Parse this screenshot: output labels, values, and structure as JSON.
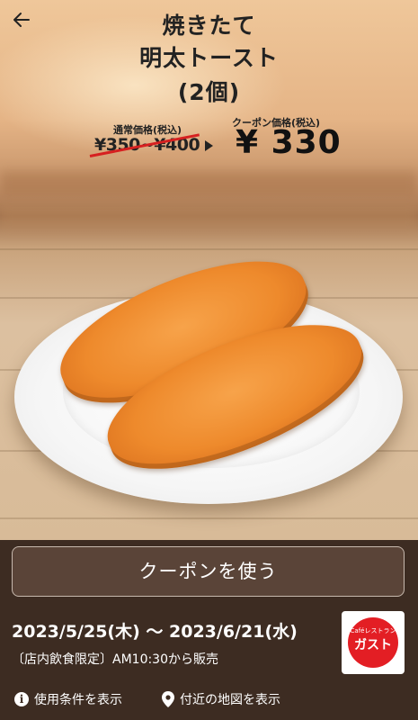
{
  "product": {
    "title_line1": "焼きたて",
    "title_line2": "明太トースト",
    "title_line3": "(2個)"
  },
  "price": {
    "regular_label": "通常価格(税込)",
    "regular_value": "¥350~¥400",
    "coupon_label": "クーポン価格(税込)",
    "coupon_value": "¥ 330"
  },
  "actions": {
    "use_coupon_label": "クーポンを使う"
  },
  "validity": {
    "period": "2023/5/25(木) 〜 2023/6/21(水)",
    "note": "〔店内飲食限定〕AM10:30から販売"
  },
  "brand": {
    "cafe_text": "Caféレストラン",
    "name": "ガスト"
  },
  "links": {
    "terms_label": "使用条件を表示",
    "map_label": "付近の地図を表示"
  },
  "icons": [
    "back-arrow-icon",
    "info-icon",
    "location-pin-icon"
  ],
  "colors": {
    "accent_red": "#e31e24",
    "bottom_bg": "#3d2c22",
    "strike_red": "#d62020"
  }
}
